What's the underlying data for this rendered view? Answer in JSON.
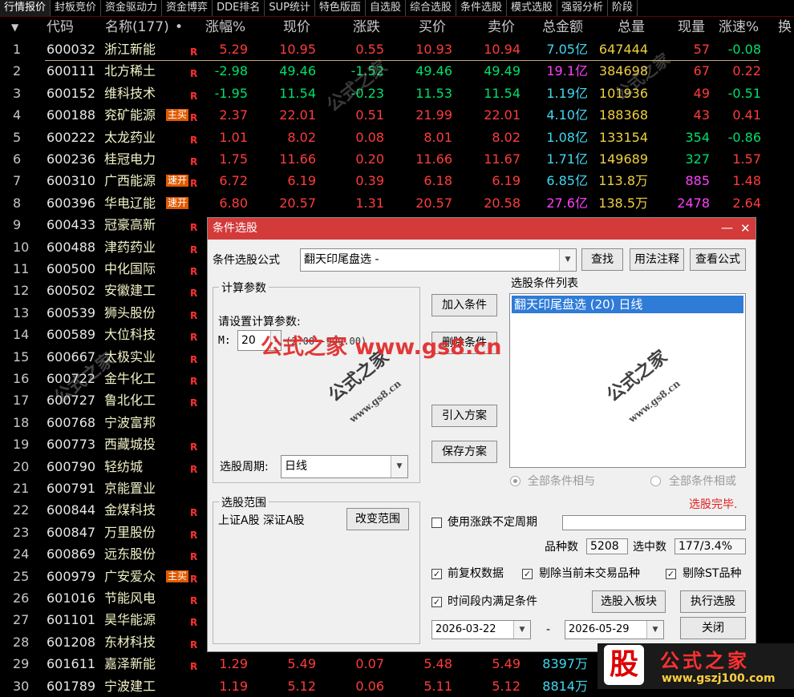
{
  "tabs": [
    "行情报价",
    "封板竞价",
    "资金驱动力",
    "资金博弈",
    "DDE排名",
    "SUP统计",
    "特色版面",
    "自选股",
    "综合选股",
    "条件选股",
    "模式选股",
    "强弱分析",
    "阶段"
  ],
  "header": {
    "arrow": "▼",
    "code": "代码",
    "name": "名称(177)",
    "dot": "•",
    "pct": "涨幅%",
    "price": "现价",
    "change": "涨跌",
    "bid": "买价",
    "ask": "卖价",
    "amount": "总金额",
    "vol": "总量",
    "cur": "现量",
    "speed": "涨速%",
    "turn": "换"
  },
  "rows": [
    {
      "n": "1",
      "code": "600032",
      "name": "浙江新能",
      "tag": "",
      "r": "R",
      "pct": "5.29",
      "price": "10.95",
      "chg": "0.55",
      "bid": "10.93",
      "ask": "10.94",
      "amt": "7.05亿",
      "vol": "647444",
      "cur": "57",
      "spd": "-0.08"
    },
    {
      "n": "2",
      "code": "600111",
      "name": "北方稀土",
      "tag": "",
      "r": "R",
      "pct": "-2.98",
      "price": "49.46",
      "chg": "-1.52",
      "bid": "49.46",
      "ask": "49.49",
      "amt": "19.1亿",
      "vol": "384698",
      "cur": "67",
      "spd": "0.22"
    },
    {
      "n": "3",
      "code": "600152",
      "name": "维科技术",
      "tag": "",
      "r": "R",
      "pct": "-1.95",
      "price": "11.54",
      "chg": "-0.23",
      "bid": "11.53",
      "ask": "11.54",
      "amt": "1.19亿",
      "vol": "101936",
      "cur": "49",
      "spd": "-0.51"
    },
    {
      "n": "4",
      "code": "600188",
      "name": "兖矿能源",
      "tag": "主买",
      "r": "R",
      "pct": "2.37",
      "price": "22.01",
      "chg": "0.51",
      "bid": "21.99",
      "ask": "22.01",
      "amt": "4.10亿",
      "vol": "188368",
      "cur": "43",
      "spd": "0.41"
    },
    {
      "n": "5",
      "code": "600222",
      "name": "太龙药业",
      "tag": "",
      "r": "R",
      "pct": "1.01",
      "price": "8.02",
      "chg": "0.08",
      "bid": "8.01",
      "ask": "8.02",
      "amt": "1.08亿",
      "vol": "133154",
      "cur": "354",
      "spd": "-0.86"
    },
    {
      "n": "6",
      "code": "600236",
      "name": "桂冠电力",
      "tag": "",
      "r": "R",
      "pct": "1.75",
      "price": "11.66",
      "chg": "0.20",
      "bid": "11.66",
      "ask": "11.67",
      "amt": "1.71亿",
      "vol": "149689",
      "cur": "327",
      "spd": "1.57"
    },
    {
      "n": "7",
      "code": "600310",
      "name": "广西能源",
      "tag": "速开",
      "r": "R",
      "pct": "6.72",
      "price": "6.19",
      "chg": "0.39",
      "bid": "6.18",
      "ask": "6.19",
      "amt": "6.85亿",
      "vol": "113.8万",
      "cur": "885",
      "spd": "1.48"
    },
    {
      "n": "8",
      "code": "600396",
      "name": "华电辽能",
      "tag": "速开",
      "r": "",
      "pct": "6.80",
      "price": "20.57",
      "chg": "1.31",
      "bid": "20.57",
      "ask": "20.58",
      "amt": "27.6亿",
      "vol": "138.5万",
      "cur": "2478",
      "spd": "2.64"
    },
    {
      "n": "9",
      "code": "600433",
      "name": "冠豪高新",
      "tag": "",
      "r": "R"
    },
    {
      "n": "10",
      "code": "600488",
      "name": "津药药业",
      "tag": "",
      "r": "R"
    },
    {
      "n": "11",
      "code": "600500",
      "name": "中化国际",
      "tag": "",
      "r": "R"
    },
    {
      "n": "12",
      "code": "600502",
      "name": "安徽建工",
      "tag": "",
      "r": "R"
    },
    {
      "n": "13",
      "code": "600539",
      "name": "狮头股份",
      "tag": "",
      "r": "R"
    },
    {
      "n": "14",
      "code": "600589",
      "name": "大位科技",
      "tag": "",
      "r": "R"
    },
    {
      "n": "15",
      "code": "600667",
      "name": "太极实业",
      "tag": "",
      "r": "R"
    },
    {
      "n": "16",
      "code": "600722",
      "name": "金牛化工",
      "tag": "",
      "r": "R"
    },
    {
      "n": "17",
      "code": "600727",
      "name": "鲁北化工",
      "tag": "",
      "r": "R"
    },
    {
      "n": "18",
      "code": "600768",
      "name": "宁波富邦",
      "tag": "",
      "r": ""
    },
    {
      "n": "19",
      "code": "600773",
      "name": "西藏城投",
      "tag": "",
      "r": "R"
    },
    {
      "n": "20",
      "code": "600790",
      "name": "轻纺城",
      "tag": "",
      "r": "R"
    },
    {
      "n": "21",
      "code": "600791",
      "name": "京能置业",
      "tag": "",
      "r": ""
    },
    {
      "n": "22",
      "code": "600844",
      "name": "金煤科技",
      "tag": "",
      "r": "R"
    },
    {
      "n": "23",
      "code": "600847",
      "name": "万里股份",
      "tag": "",
      "r": "R"
    },
    {
      "n": "24",
      "code": "600869",
      "name": "远东股份",
      "tag": "",
      "r": "R"
    },
    {
      "n": "25",
      "code": "600979",
      "name": "广安爱众",
      "tag": "主买",
      "r": "R"
    },
    {
      "n": "26",
      "code": "601016",
      "name": "节能风电",
      "tag": "",
      "r": "R"
    },
    {
      "n": "27",
      "code": "601101",
      "name": "昊华能源",
      "tag": "",
      "r": "R"
    },
    {
      "n": "28",
      "code": "601208",
      "name": "东材科技",
      "tag": "",
      "r": "R"
    },
    {
      "n": "29",
      "code": "601611",
      "name": "嘉泽新能",
      "tag": "",
      "r": "R",
      "pct": "1.29",
      "price": "5.49",
      "chg": "0.07",
      "bid": "5.48",
      "ask": "5.49",
      "amt": "8397万"
    },
    {
      "n": "30",
      "code": "601789",
      "name": "宁波建工",
      "tag": "",
      "r": "",
      "pct": "1.19",
      "price": "5.12",
      "chg": "0.06",
      "bid": "5.11",
      "ask": "5.12",
      "amt": "8814万"
    }
  ],
  "dialog": {
    "title": "条件选股",
    "minimize": "—",
    "close": "✕",
    "formula_label": "条件选股公式",
    "formula_value": "翻天印尾盘选  -",
    "btn_find": "查找",
    "btn_usage": "用法注释",
    "btn_view": "查看公式",
    "calc_group": "计算参数",
    "calc_prompt": "请设置计算参数:",
    "param_name": "M:",
    "param_value": "20",
    "param_range": "(2.00--999.00)",
    "period_label": "选股周期:",
    "period_value": "日线",
    "btn_add": "加入条件",
    "btn_delete": "删除条件",
    "btn_import": "引入方案",
    "btn_save": "保存方案",
    "cond_list_label": "选股条件列表",
    "cond_item": "翻天印尾盘选 (20) 日线",
    "radio_and": "全部条件相与",
    "radio_or": "全部条件相或",
    "range_group": "选股范围",
    "range_value": "上证A股 深证A股",
    "btn_change_range": "改变范围",
    "status": "选股完毕.",
    "chk_uncertain": "使用涨跌不定周期",
    "count_label": "品种数",
    "count_value": "5208",
    "hit_label": "选中数",
    "hit_value": "177/3.4%",
    "chk_adjust": "前复权数据",
    "chk_exclude_untraded": "剔除当前未交易品种",
    "chk_exclude_st": "剔除ST品种",
    "chk_timerange": "时间段内满足条件",
    "btn_to_block": "选股入板块",
    "btn_execute": "执行选股",
    "date_from": "2026-03-22",
    "date_sep": "-",
    "date_to": "2026-05-29",
    "btn_close": "关闭"
  },
  "watermark": {
    "main": "公式之家 www.gs8.cn",
    "stamp_cn": "公式之家",
    "stamp_url": "www.gs8.cn"
  },
  "logo": {
    "badge": "股",
    "title": "公式之家",
    "url": "www.gszj100.com"
  }
}
